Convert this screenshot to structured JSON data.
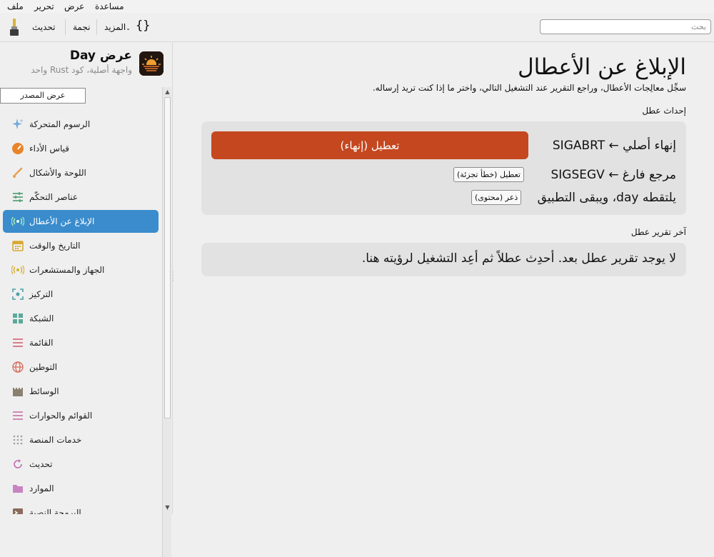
{
  "menubar": {
    "items": [
      "ملف",
      "تحرير",
      "عرض",
      "مساعدة"
    ]
  },
  "toolbar": {
    "update_label": "تحديث",
    "star_label": "نجمة",
    "more_label": "المزيد",
    "braces_label": "{}",
    "search_placeholder": "بحث"
  },
  "sidebar": {
    "app_title": "عرض Day",
    "app_subtitle": "واجهة أصلية، كود Rust واحد",
    "view_source_label": "عرض المصدر",
    "items": [
      {
        "label": "الرسوم المتحركة",
        "icon": "sparkle-icon"
      },
      {
        "label": "قياس الأداء",
        "icon": "speedometer-icon"
      },
      {
        "label": "اللوحة والأشكال",
        "icon": "brush-icon"
      },
      {
        "label": "عناصر التحكّم",
        "icon": "sliders-icon"
      },
      {
        "label": "الإبلاغ عن الأعطال",
        "icon": "broadcast-icon",
        "active": true
      },
      {
        "label": "التاريخ والوقت",
        "icon": "calendar-icon"
      },
      {
        "label": "الجهاز والمستشعرات",
        "icon": "sensor-icon"
      },
      {
        "label": "التركيز",
        "icon": "focus-icon"
      },
      {
        "label": "الشبكة",
        "icon": "grid-icon"
      },
      {
        "label": "القائمة",
        "icon": "list-icon"
      },
      {
        "label": "التوطين",
        "icon": "globe-icon"
      },
      {
        "label": "الوسائط",
        "icon": "film-icon"
      },
      {
        "label": "القوائم والحوارات",
        "icon": "menu-icon"
      },
      {
        "label": "خدمات المنصة",
        "icon": "dots-icon"
      },
      {
        "label": "تحديث",
        "icon": "refresh-icon"
      },
      {
        "label": "الموارد",
        "icon": "folder-icon"
      },
      {
        "label": "البرمجة النصية",
        "icon": "terminal-icon"
      }
    ]
  },
  "main": {
    "title": "الإبلاغ عن الأعطال",
    "description": "سجِّل معالِجات الأعطال، وراجع التقرير عند التشغيل التالي، واختر ما إذا كنت تريد إرساله.",
    "trigger_section": "إحداث عطل",
    "rows": {
      "abort_label": "إنهاء أصلي ← SIGABRT",
      "abort_button": "تعطيل (إنهاء)",
      "segv_label": "مرجع فارغ ← SIGSEGV",
      "segv_button": "تعطيل (خطأ تجزئة)",
      "panic_label": "يلتقطه day، ويبقى التطبيق",
      "panic_button": "ذعر (محتوى)"
    },
    "report_section": "آخر تقرير عطل",
    "report_text": "لا يوجد تقرير عطل بعد. أحدِث عطلاً ثم أعِد التشغيل لرؤيته هنا."
  },
  "colors": {
    "accent": "#3a8ccc",
    "danger": "#c4471f"
  }
}
